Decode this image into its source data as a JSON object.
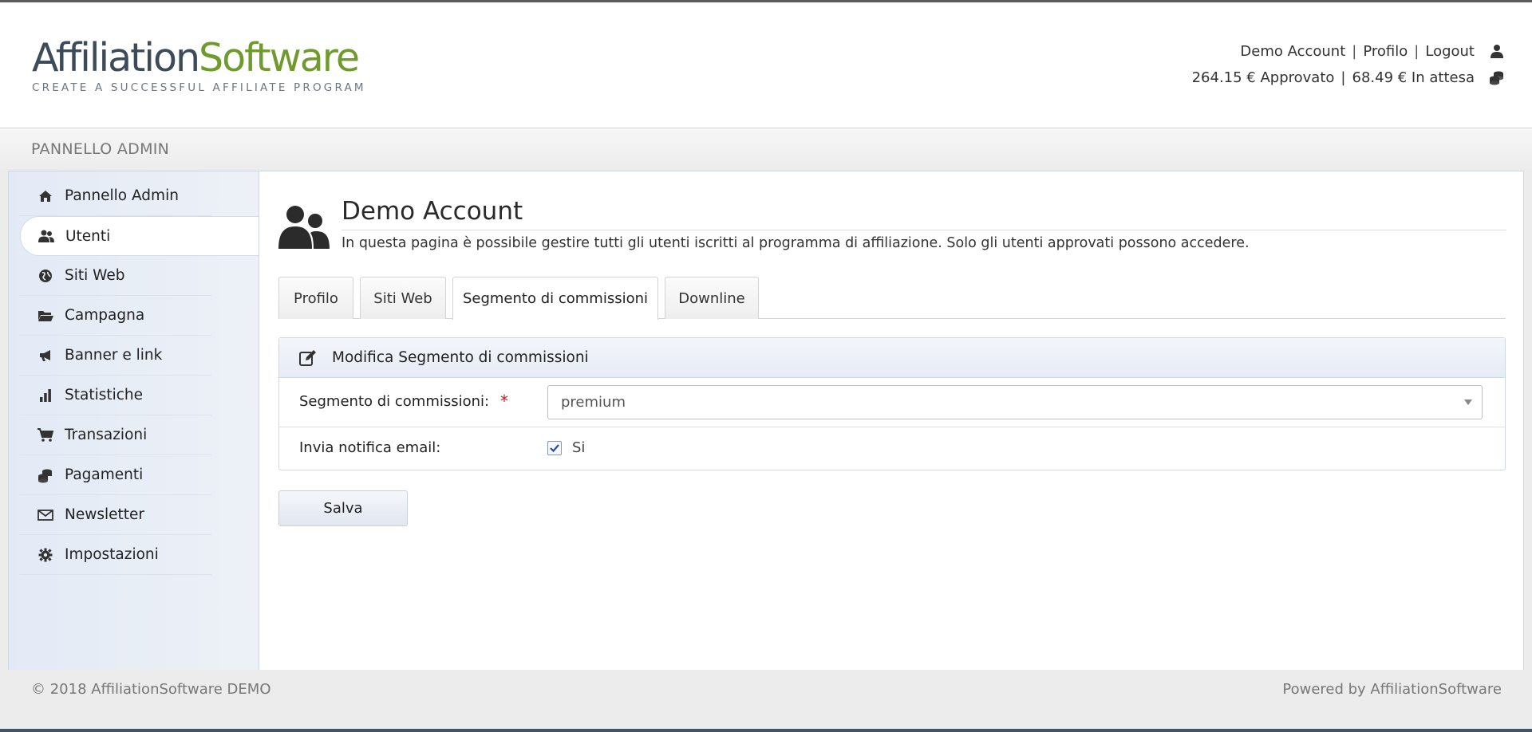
{
  "header": {
    "logo": {
      "part1": "Affiliation",
      "part2": "Software",
      "tagline": "CREATE A SUCCESSFUL AFFILIATE PROGRAM"
    },
    "user_links": {
      "account": "Demo Account",
      "separator": "|",
      "profile": "Profilo",
      "logout": "Logout",
      "icon": "user-icon"
    },
    "balance": {
      "approved": "264.15 € Approvato",
      "separator": "|",
      "pending": "68.49 € In attesa",
      "icon": "coins-icon"
    }
  },
  "adminbar": {
    "title": "PANNELLO ADMIN"
  },
  "sidebar": {
    "items": [
      {
        "label": "Pannello Admin",
        "icon": "home-icon",
        "active": false
      },
      {
        "label": "Utenti",
        "icon": "users-icon",
        "active": true
      },
      {
        "label": "Siti Web",
        "icon": "globe-icon",
        "active": false
      },
      {
        "label": "Campagna",
        "icon": "folder-icon",
        "active": false
      },
      {
        "label": "Banner e link",
        "icon": "megaphone-icon",
        "active": false
      },
      {
        "label": "Statistiche",
        "icon": "bar-chart-icon",
        "active": false
      },
      {
        "label": "Transazioni",
        "icon": "cart-icon",
        "active": false
      },
      {
        "label": "Pagamenti",
        "icon": "coins-icon",
        "active": false
      },
      {
        "label": "Newsletter",
        "icon": "envelope-icon",
        "active": false
      },
      {
        "label": "Impostazioni",
        "icon": "gear-icon",
        "active": false
      }
    ]
  },
  "main": {
    "title": "Demo Account",
    "title_icon": "users-icon",
    "description": "In questa pagina è possibile gestire tutti gli utenti iscritti al programma di affiliazione. Solo gli utenti approvati possono accedere.",
    "tabs": [
      {
        "label": "Profilo",
        "active": false
      },
      {
        "label": "Siti Web",
        "active": false
      },
      {
        "label": "Segmento di commissioni",
        "active": true
      },
      {
        "label": "Downline",
        "active": false
      }
    ],
    "panel": {
      "title": "Modifica Segmento di commissioni",
      "icon": "edit-icon",
      "segment_label": "Segmento di commissioni:",
      "required_mark": "*",
      "segment_value": "premium",
      "notify_label": "Invia notifica email:",
      "notify_checked": true,
      "notify_option": "Si"
    },
    "save_label": "Salva"
  },
  "footer": {
    "left": "© 2018 AffiliationSoftware DEMO",
    "right": "Powered by AffiliationSoftware"
  },
  "colors": {
    "brand_dark": "#3d4a57",
    "brand_green": "#6f9a2e",
    "required": "#b32121"
  }
}
